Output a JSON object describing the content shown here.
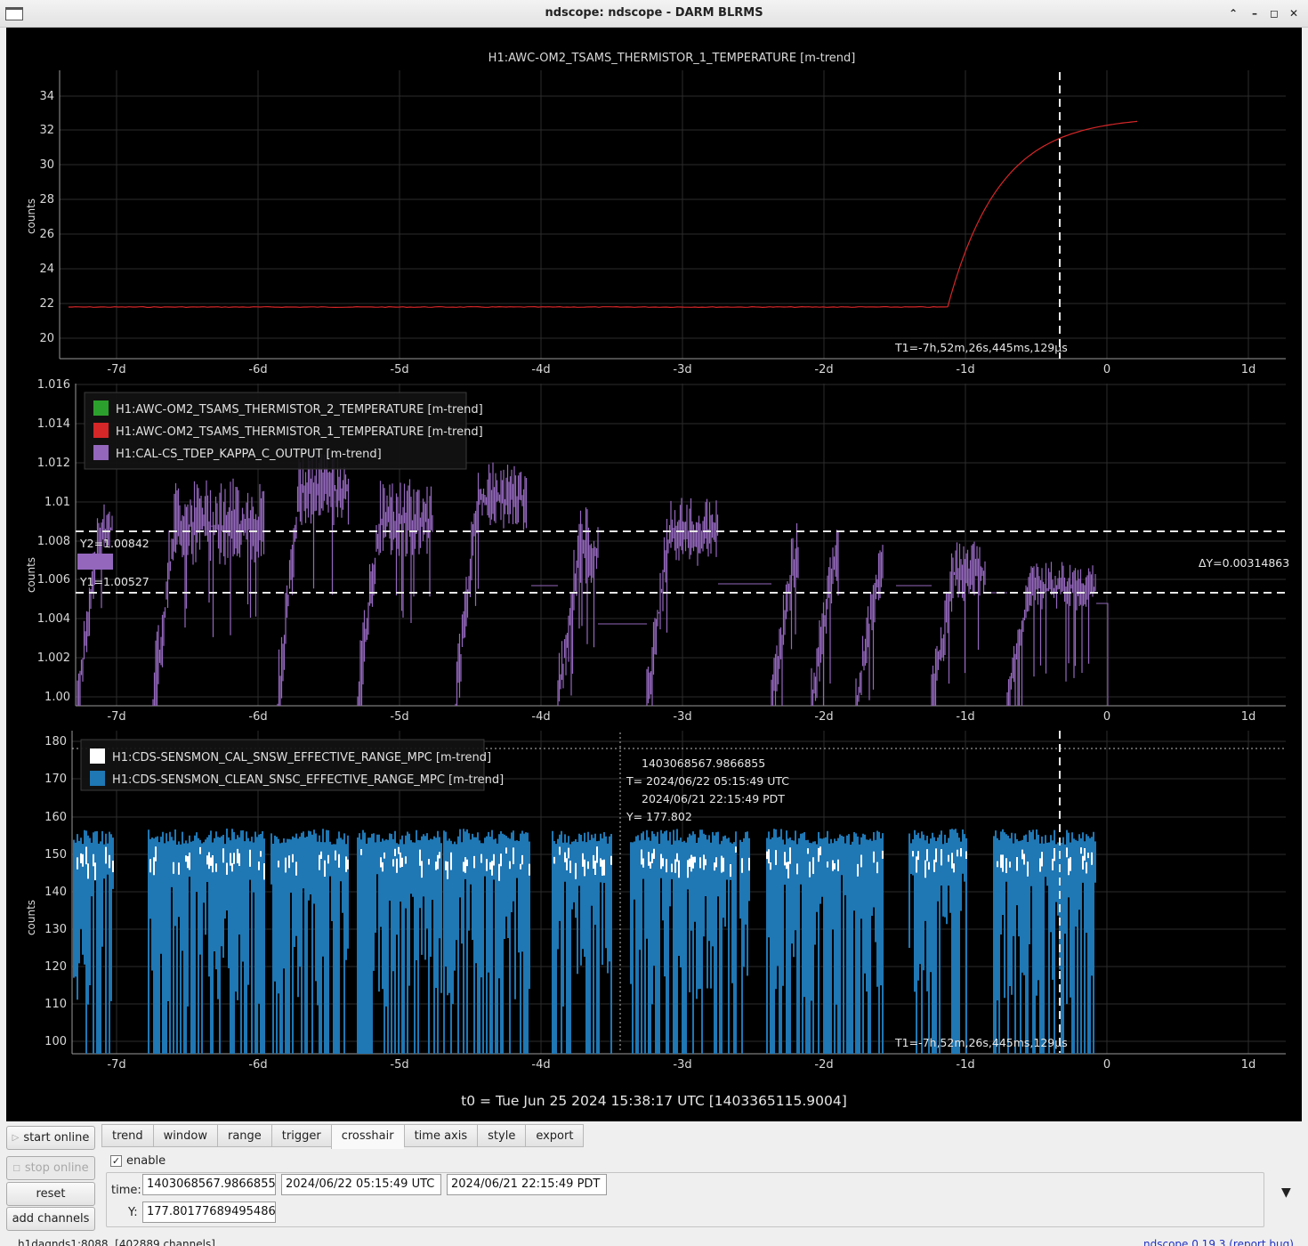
{
  "window": {
    "title": "ndscope: ndscope - DARM BLRMS"
  },
  "plots": {
    "xticks": [
      "-7d",
      "-6d",
      "-5d",
      "-4d",
      "-3d",
      "-2d",
      "-1d",
      "0",
      "1d"
    ],
    "t0_label": "t0 = Tue Jun 25 2024 15:38:17 UTC [1403365115.9004]",
    "top": {
      "title": "H1:AWC-OM2_TSAMS_THERMISTOR_1_TEMPERATURE [m-trend]",
      "ylabel": "counts",
      "yticks": [
        "34",
        "32",
        "30",
        "28",
        "26",
        "24",
        "22",
        "20"
      ],
      "cursor_label": "T1=-7h,52m,26s,445ms,129µs",
      "color": "#d62728"
    },
    "middle": {
      "ylabel": "counts",
      "yticks": [
        "1.016",
        "1.014",
        "1.012",
        "1.01",
        "1.008",
        "1.006",
        "1.004",
        "1.002",
        "1.00"
      ],
      "legend": [
        {
          "label": "H1:AWC-OM2_TSAMS_THERMISTOR_2_TEMPERATURE [m-trend]",
          "color": "#2ca02c"
        },
        {
          "label": "H1:AWC-OM2_TSAMS_THERMISTOR_1_TEMPERATURE [m-trend]",
          "color": "#d62728"
        },
        {
          "label": "H1:CAL-CS_TDEP_KAPPA_C_OUTPUT [m-trend]",
          "color": "#9467bd"
        }
      ],
      "y2_label": "Y2=1.00842",
      "y1_label": "Y1=1.00527",
      "dy_label": "ΔY=0.00314863"
    },
    "bottom": {
      "ylabel": "counts",
      "yticks": [
        "180",
        "170",
        "160",
        "150",
        "140",
        "130",
        "120",
        "110",
        "100"
      ],
      "legend": [
        {
          "label": "H1:CDS-SENSMON_CAL_SNSW_EFFECTIVE_RANGE_MPC [m-trend]",
          "color": "#ffffff"
        },
        {
          "label": "H1:CDS-SENSMON_CLEAN_SNSC_EFFECTIVE_RANGE_MPC [m-trend]",
          "color": "#1f77b4"
        }
      ],
      "crosshair": {
        "gps": "1403068567.9866855",
        "utc": "T= 2024/06/22 05:15:49 UTC",
        "pdt": "2024/06/21 22:15:49 PDT",
        "y": "Y= 177.802"
      },
      "cursor_label": "T1=-7h,52m,26s,445ms,129µs"
    }
  },
  "controls": {
    "start_online": "start online",
    "stop_online": "stop online",
    "reset": "reset",
    "add_channels": "add channels",
    "tabs": [
      "trend",
      "window",
      "range",
      "trigger",
      "crosshair",
      "time axis",
      "style",
      "export"
    ],
    "active_tab": "crosshair",
    "enable_label": "enable",
    "enable_checked": true,
    "time_label": "time:",
    "time_gps": "1403068567.9866855",
    "time_utc": "2024/06/22 05:15:49 UTC",
    "time_pdt": "2024/06/21 22:15:49 PDT",
    "y_label": "Y:",
    "y_value": "177.80177689495486"
  },
  "status": {
    "server": "h1daqnds1:8088, [402889 channels]",
    "version": "ndscope 0.19.3 (report bug)"
  }
}
